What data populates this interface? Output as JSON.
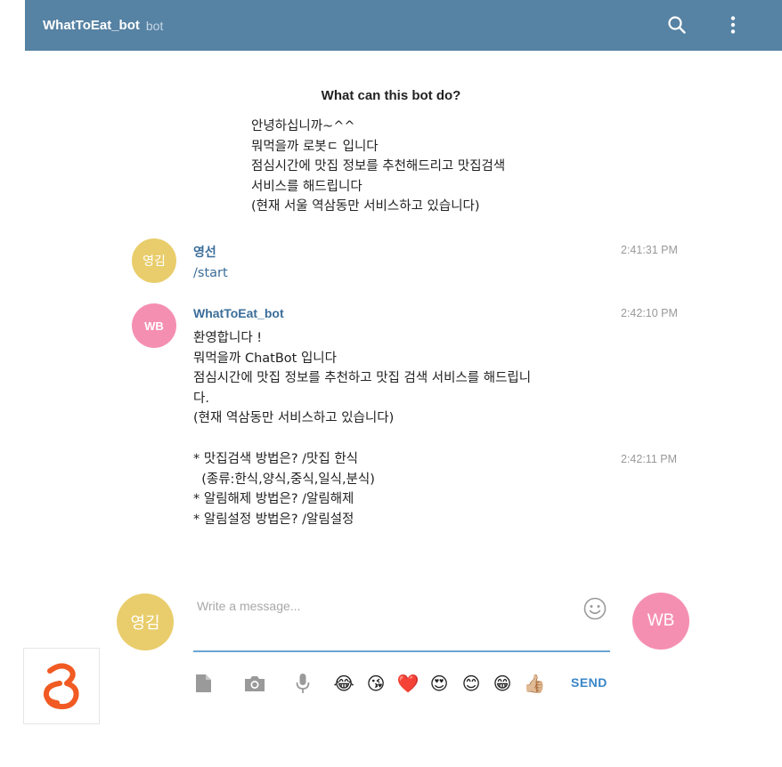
{
  "header": {
    "title": "WhatToEat_bot",
    "subtitle": "bot"
  },
  "intro": {
    "title": "What can this bot do?",
    "lines": [
      "안녕하십니까~^^",
      "뭐먹을까 로봇ㄷ 입니다",
      "점심시간에 맛집 정보를 추천해드리고 맛집검색",
      "서비스를 해드립니다",
      "(현재 서울 역삼동만 서비스하고 있습니다)"
    ]
  },
  "messages": [
    {
      "avatar": "영김",
      "sender": "영선",
      "time": "2:41:31 PM",
      "text": "/start"
    },
    {
      "avatar": "WB",
      "sender": "WhatToEat_bot",
      "time": "2:42:10 PM",
      "lines": [
        "환영합니다 !",
        "뭐먹을까 ChatBot 입니다",
        "점심시간에 맛집 정보를 추천하고 맛집 검색 서비스를 해드립니",
        "다.",
        "(현재 역삼동만 서비스하고 있습니다)"
      ]
    },
    {
      "time": "2:42:11 PM",
      "lines": [
        "* 맛집검색 방법은? /맛집 한식",
        "  (종류:한식,양식,중식,일식,분식)",
        "* 알림해제 방법은? /알림해제",
        "* 알림설정 방법은? /알림설정"
      ]
    }
  ],
  "composer": {
    "user_avatar": "영김",
    "bot_avatar": "WB",
    "placeholder": "Write a message...",
    "send_label": "SEND",
    "emojis": [
      "😂",
      "😘",
      "❤️",
      "😍",
      "😊",
      "😁",
      "👍🏼"
    ]
  },
  "colors": {
    "header_bg": "#5682a3",
    "sender_blue": "#3a6d99",
    "avatar_yellow": "#e9cd6c",
    "avatar_pink": "#f58fb2",
    "send_blue": "#3a86c8",
    "logo_orange": "#f15a22"
  },
  "icons": {
    "search": "search-icon",
    "more": "more-vertical-icon",
    "smile": "smile-icon",
    "file": "file-icon",
    "camera": "camera-icon",
    "mic": "microphone-icon",
    "logo": "logo-icon"
  }
}
